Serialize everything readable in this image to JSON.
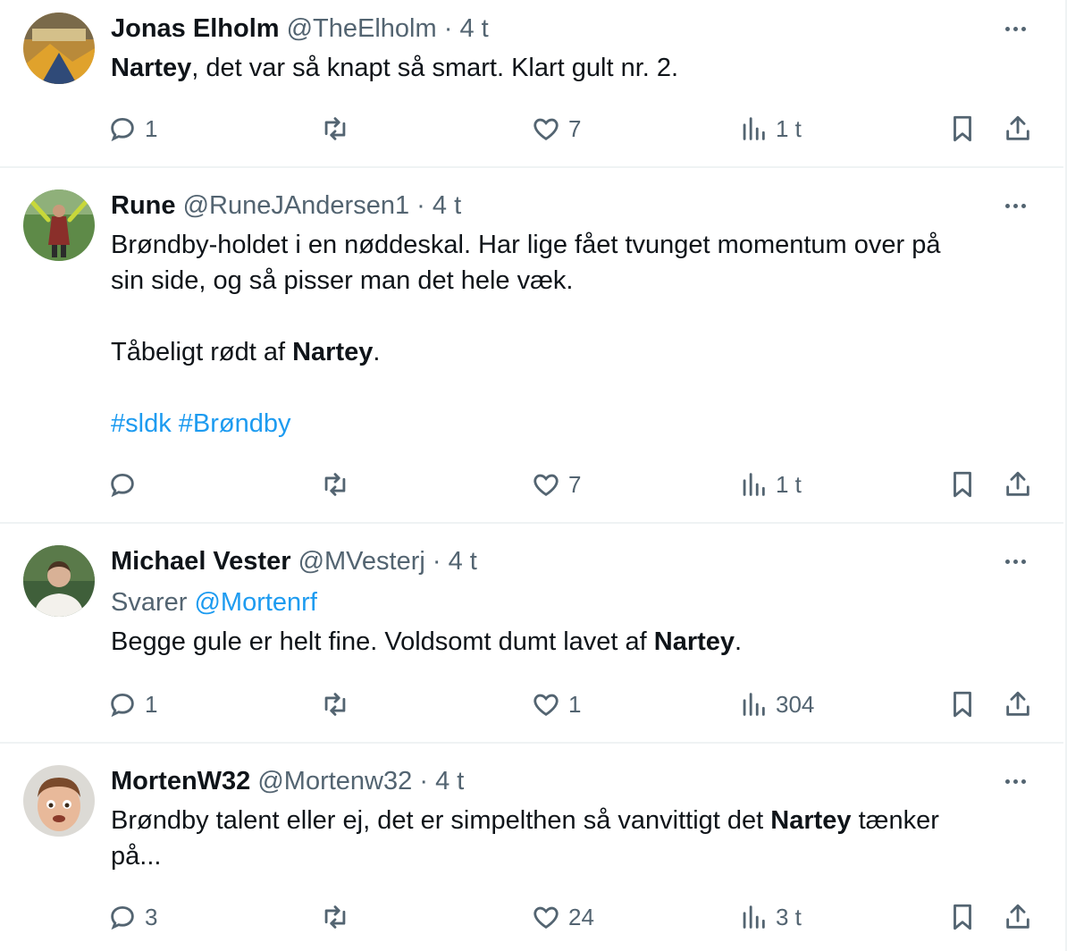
{
  "tweets": [
    {
      "display_name": "Jonas Elholm",
      "handle": "@TheElholm",
      "separator": "·",
      "time": "4 t",
      "replying_prefix": "",
      "replying_to": "",
      "text_parts": [
        {
          "bold": "Nartey",
          "rest": ", det var så knapt så smart. Klart gult nr. 2."
        }
      ],
      "reply_count": "1",
      "retweet_count": "",
      "like_count": "7",
      "view_count": "1 t",
      "avatar_colors": [
        "#c7a14a",
        "#3d5a80"
      ]
    },
    {
      "display_name": "Rune",
      "handle": "@RuneJAndersen1",
      "separator": "·",
      "time": "4 t",
      "text_lines": [
        "Brøndby-holdet i en nøddeskal. Har lige fået tvunget momentum over på",
        "sin side, og så pisser man det hele væk."
      ],
      "text2_pre": "Tåbeligt rødt af ",
      "text2_bold": "Nartey",
      "text2_post": ".",
      "hashtags": "#sldk #Brøndby",
      "reply_count": "",
      "retweet_count": "",
      "like_count": "7",
      "view_count": "1 t",
      "avatar_colors": [
        "#6b8f4e",
        "#8a3b2e"
      ]
    },
    {
      "display_name": "Michael Vester",
      "handle": "@MVesterj",
      "separator": "·",
      "time": "4 t",
      "replying_prefix": "Svarer ",
      "replying_to": "@Mortenrf",
      "text_pre": "Begge gule er helt fine. Voldsomt dumt lavet af ",
      "text_bold": "Nartey",
      "text_post": ".",
      "reply_count": "1",
      "retweet_count": "",
      "like_count": "1",
      "view_count": "304",
      "avatar_colors": [
        "#3e5a3a",
        "#f1efe9"
      ]
    },
    {
      "display_name": "MortenW32",
      "handle": "@Mortenw32",
      "separator": "·",
      "time": "4 t",
      "text_pre": "Brøndby talent eller ej, det er simpelthen så vanvittigt det ",
      "text_bold": "Nartey",
      "text_post": " tænker",
      "text_line2": "på...",
      "reply_count": "3",
      "retweet_count": "",
      "like_count": "24",
      "view_count": "3 t",
      "avatar_colors": [
        "#d9d7d2",
        "#7a4a2b"
      ]
    }
  ],
  "colors": {
    "text": "#0f1419",
    "secondary": "#536471",
    "link": "#1d9bf0",
    "divider": "#eff3f4"
  },
  "icons": [
    "more-icon",
    "reply-icon",
    "retweet-icon",
    "like-icon",
    "views-icon",
    "bookmark-icon",
    "share-icon"
  ]
}
